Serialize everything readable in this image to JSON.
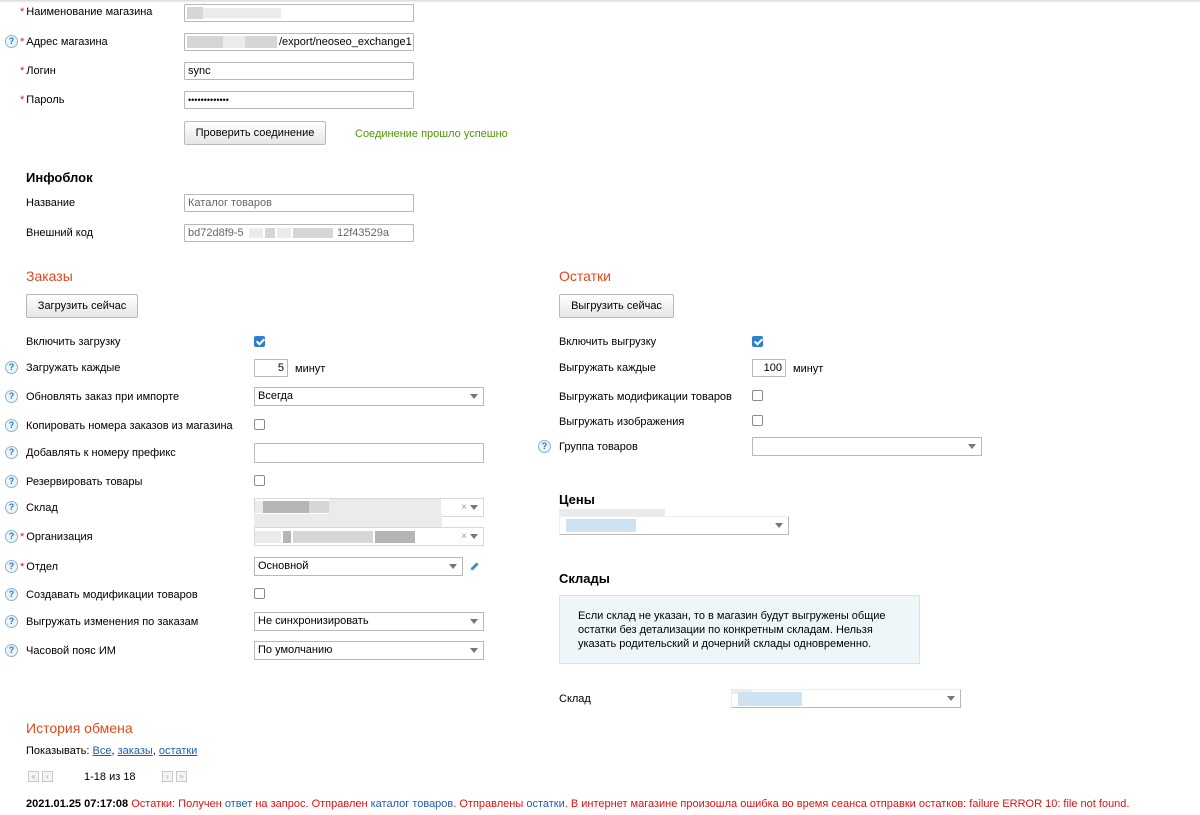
{
  "connection": {
    "store_name_label": "Наименование магазина",
    "store_address_label": "Адрес магазина",
    "store_address_value": "/export/neoseo_exchange1",
    "login_label": "Логин",
    "login_value": "sync",
    "password_label": "Пароль",
    "password_value": "•••••••••••••",
    "check_button": "Проверить соединение",
    "check_status": "Соединение прошло успешно",
    "required_mark": "*",
    "help_mark": "?"
  },
  "infoblock": {
    "title": "Инфоблок",
    "name_label": "Название",
    "name_value": "Каталог товаров",
    "ext_code_label": "Внешний код",
    "ext_code_prefix": "bd72d8f9-5",
    "ext_code_suffix": "12f43529a"
  },
  "orders": {
    "title": "Заказы",
    "load_now_button": "Загрузить сейчас",
    "enable_label": "Включить загрузку",
    "enable_checked": true,
    "interval_label": "Загружать каждые",
    "interval_value": "5",
    "interval_unit": "минут",
    "update_label": "Обновлять заказ при импорте",
    "update_value": "Всегда",
    "copy_numbers_label": "Копировать номера заказов из магазина",
    "prefix_label": "Добавлять к номеру префикс",
    "prefix_value": "",
    "reserve_label": "Резервировать товары",
    "warehouse_label": "Склад",
    "organization_label": "Организация",
    "department_label": "Отдел",
    "department_value": "Основной",
    "create_mods_label": "Создавать модификации товаров",
    "export_changes_label": "Выгружать изменения по заказам",
    "export_changes_value": "Не синхронизировать",
    "timezone_label": "Часовой пояс ИМ",
    "timezone_value": "По умолчанию",
    "clear_mark": "×"
  },
  "stock": {
    "title": "Остатки",
    "export_now_button": "Выгрузить сейчас",
    "enable_label": "Включить выгрузку",
    "enable_checked": true,
    "interval_label": "Выгружать каждые",
    "interval_value": "100",
    "interval_unit": "минут",
    "export_mods_label": "Выгружать модификации товаров",
    "export_images_label": "Выгружать изображения",
    "product_group_label": "Группа товаров",
    "prices_title": "Цены",
    "warehouses_title": "Склады",
    "warehouses_info": "Если склад не указан, то в магазин будут выгружены общие остатки без детализации по конкретным складам. Нельзя указать родительский и дочерний склады одновременно.",
    "warehouse_label": "Склад"
  },
  "history": {
    "title": "История обмена",
    "show_label": "Показывать:",
    "filter_all": "Все",
    "filter_orders": "заказы",
    "filter_stock": "остатки",
    "sep": ",",
    "pagination": "1-18 из 18",
    "log_date": "2021.01.25 07:17:08",
    "log_p1": "Остатки: Получен",
    "log_p2": "ответ",
    "log_p3": "на запрос. Отправлен",
    "log_p4": "каталог товаров",
    "log_p5": ". Отправлены",
    "log_p6": "остатки",
    "log_p7": ". В интернет магазине произошла ошибка во время сеанса отправки остатков: failure ERROR 10: file not found."
  },
  "colors": {
    "section_title": "#e04a1a",
    "success": "#4d9a00",
    "error": "#e01010",
    "link": "#1a5fb0",
    "checkbox": "#2e7fd0"
  }
}
